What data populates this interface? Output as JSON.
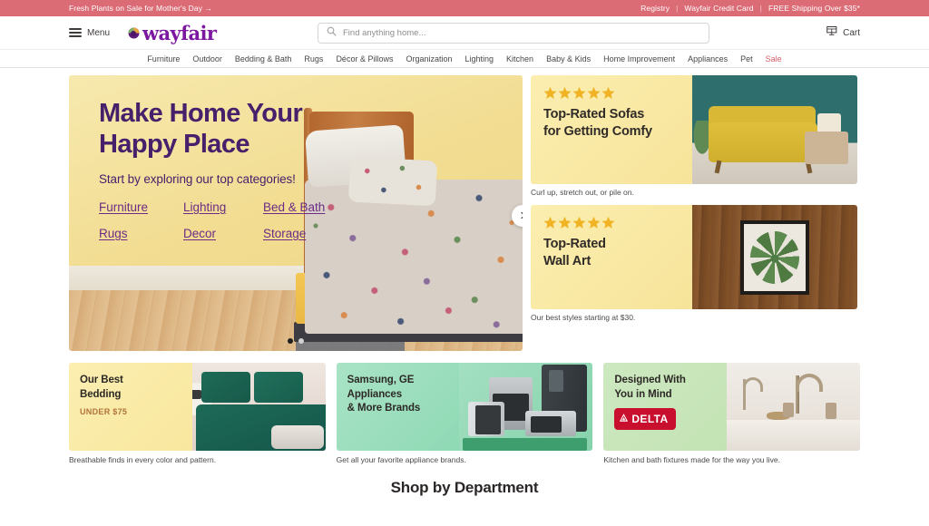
{
  "promo_bar": {
    "left_text": "Fresh Plants on Sale for Mother's Day →",
    "links": [
      "Registry",
      "Wayfair Credit Card",
      "FREE Shipping Over $35*"
    ],
    "separator": "|",
    "background_color": "#db6b75"
  },
  "header": {
    "menu_label": "Menu",
    "menu_icon": "hamburger-icon",
    "logo_text": "wayfair",
    "logo_color": "#7b189f",
    "search": {
      "placeholder": "Find anything home...",
      "value": "",
      "icon": "search-icon"
    },
    "cart_label": "Cart",
    "cart_icon": "shopping-cart-icon"
  },
  "nav": {
    "items": [
      {
        "label": "Furniture",
        "sale": false
      },
      {
        "label": "Outdoor",
        "sale": false
      },
      {
        "label": "Bedding & Bath",
        "sale": false
      },
      {
        "label": "Rugs",
        "sale": false
      },
      {
        "label": "Décor & Pillows",
        "sale": false
      },
      {
        "label": "Organization",
        "sale": false
      },
      {
        "label": "Lighting",
        "sale": false
      },
      {
        "label": "Kitchen",
        "sale": false
      },
      {
        "label": "Baby & Kids",
        "sale": false
      },
      {
        "label": "Home Improvement",
        "sale": false
      },
      {
        "label": "Appliances",
        "sale": false
      },
      {
        "label": "Pet",
        "sale": false
      },
      {
        "label": "Sale",
        "sale": true
      }
    ],
    "sale_color": "#d4606c"
  },
  "hero": {
    "title_line1": "Make Home Your",
    "title_line2": "Happy Place",
    "subtitle": "Start by exploring our top categories!",
    "title_color": "#46206b",
    "links": [
      "Furniture",
      "Lighting",
      "Bed & Bath",
      "Rugs",
      "Decor",
      "Storage"
    ],
    "next_icon": "chevron-right-icon",
    "dots": [
      {
        "active": true
      },
      {
        "active": false
      }
    ]
  },
  "promo_cards": [
    {
      "stars": 5,
      "title_line1": "Top-Rated Sofas",
      "title_line2": "for Getting Comfy",
      "caption": "Curl up, stretch out, or pile on.",
      "scene": "sofa"
    },
    {
      "stars": 5,
      "title_line1": "Top-Rated",
      "title_line2": "Wall Art",
      "caption": "Our best styles starting at $30.",
      "scene": "wall-art"
    }
  ],
  "bottom_cards": [
    {
      "title_line1": "Our Best",
      "title_line2": "Bedding",
      "kicker": "UNDER $75",
      "kicker_color": "#b1733a",
      "caption": "Breathable finds in every color and pattern.",
      "scene": "bedding",
      "panel_color": "#f8e79e"
    },
    {
      "title_line1": "Samsung, GE Appliances",
      "title_line2": "& More Brands",
      "kicker": "",
      "caption": "Get all your favorite appliance brands.",
      "scene": "appliances",
      "panel_color": "#8fd9b5"
    },
    {
      "title_line1": "Designed With",
      "title_line2": "You in Mind",
      "kicker": "",
      "brand_badge": "DELTA",
      "brand_badge_color": "#c8102e",
      "caption": "Kitchen and bath fixtures made for the way you live.",
      "scene": "delta",
      "panel_color": "#c3e3b4"
    }
  ],
  "department_section": {
    "title": "Shop by Department"
  }
}
